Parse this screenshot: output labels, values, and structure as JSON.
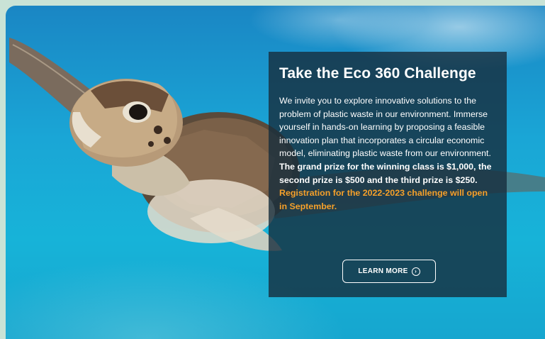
{
  "hero": {
    "title": "Take the Eco 360 Challenge",
    "body_text": "We invite you to explore innovative solutions to the problem of plastic waste in our environment. Immerse yourself in hands-on learning by proposing a feasible innovation plan that incorporates a circular economic model, eliminating plastic waste from our environment.",
    "prize_text": "The grand prize for the winning class is $1,000, the second prize is $500 and the third prize is $250.",
    "registration_text": "Registration for the 2022-2023 challenge will open in September.",
    "button_label": "LEARN MORE",
    "button_icon": "arrow-circle-right-icon"
  },
  "colors": {
    "panel_bg": "#162d3c",
    "accent_orange": "#f5a02a",
    "water": "#1aa6d6"
  }
}
